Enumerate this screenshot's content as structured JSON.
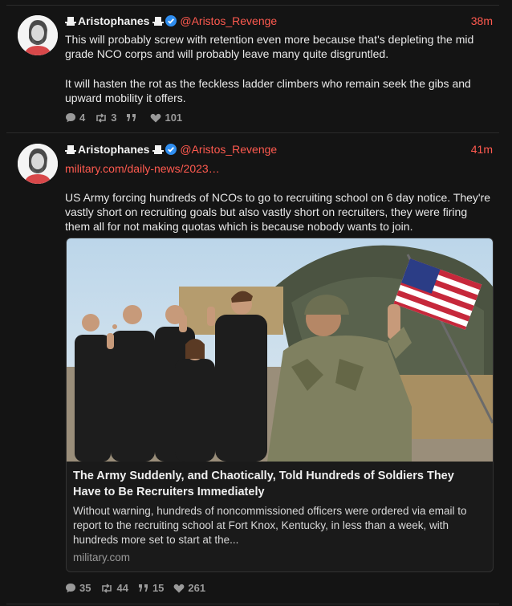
{
  "colors": {
    "accent": "#ff5a4f",
    "background": "#141414",
    "text": "#e9e9e9",
    "muted": "#9a9a9a"
  },
  "posts": [
    {
      "author": "Aristophanes",
      "handle": "@Aristos_Revenge",
      "time": "38m",
      "paragraphs": [
        "This will probably screw with retention even more because that's depleting the mid grade NCO corps and will probably leave many quite disgruntled.",
        "It will hasten the rot as the feckless ladder climbers who remain seek the gibs and upward mobility it offers."
      ],
      "stats": {
        "replies": "4",
        "reposts": "3",
        "quotes": "",
        "likes": "101"
      }
    },
    {
      "author": "Aristophanes",
      "handle": "@Aristos_Revenge",
      "time": "41m",
      "link": "military.com/daily-news/2023…",
      "paragraphs": [
        "US Army forcing hundreds of NCOs to go to recruiting school on 6 day notice. They're vastly short on recruiting goals but also vastly short on recruiters, they were firing them all for not making quotas which is because nobody wants to join."
      ],
      "card": {
        "title": "The Army Suddenly, and Chaotically, Told Hundreds of Soldiers They Have to Be Recruiters Immediately",
        "description": "Without warning, hundreds of noncommissioned officers were ordered via email to report to the recruiting school at Fort Knox, Kentucky, in less than a week, with hundreds more set to start at the...",
        "domain": "military.com"
      },
      "stats": {
        "replies": "35",
        "reposts": "44",
        "quotes": "15",
        "likes": "261"
      }
    }
  ],
  "icons": [
    "hat-icon",
    "verified-icon",
    "reply-icon",
    "repost-icon",
    "quote-icon",
    "heart-icon"
  ]
}
